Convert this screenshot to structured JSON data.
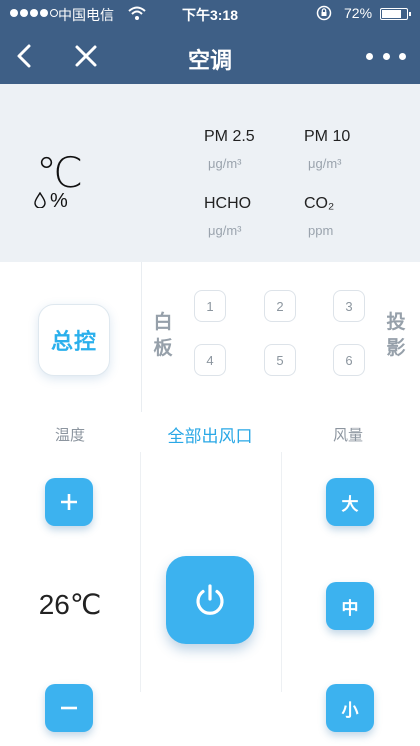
{
  "status_bar": {
    "carrier": "中国电信",
    "time": "下午3:18",
    "battery": "72%"
  },
  "nav": {
    "title": "空调"
  },
  "environment": {
    "temp_unit": "℃",
    "humidity_unit": "%",
    "sensors": [
      {
        "label": "PM 2.5",
        "unit": "μg/m³"
      },
      {
        "label": "PM 10",
        "unit": "μg/m³"
      },
      {
        "label": "HCHO",
        "unit": "μg/m³"
      },
      {
        "label": "CO₂",
        "unit": "ppm"
      }
    ]
  },
  "controls": {
    "master_label": "总控",
    "left_side_label": "白板",
    "right_side_label": "投影",
    "vents": [
      "1",
      "2",
      "3",
      "4",
      "5",
      "6"
    ],
    "temperature_label": "温度",
    "all_vents_label": "全部出风口",
    "fan_label": "风量",
    "temperature_value": "26℃",
    "fan_speeds": [
      "大",
      "中",
      "小"
    ]
  },
  "colors": {
    "header": "#3e5f86",
    "accent": "#3cb2ef",
    "panel": "#edf1f5"
  }
}
